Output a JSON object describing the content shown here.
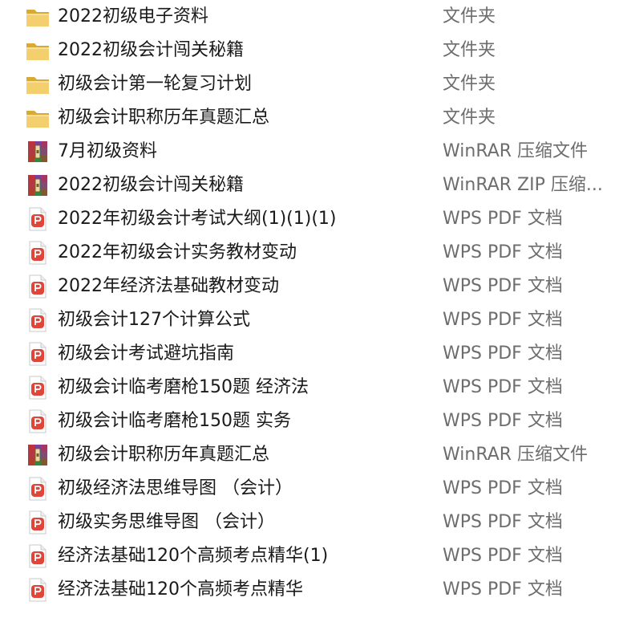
{
  "files": [
    {
      "name": "2022初级电子资料",
      "type": "文件夹",
      "icon": "folder-icon"
    },
    {
      "name": "2022初级会计闯关秘籍",
      "type": "文件夹",
      "icon": "folder-icon"
    },
    {
      "name": "初级会计第一轮复习计划",
      "type": "文件夹",
      "icon": "folder-icon"
    },
    {
      "name": "初级会计职称历年真题汇总",
      "type": "文件夹",
      "icon": "folder-icon"
    },
    {
      "name": "7月初级资料",
      "type": "WinRAR 压缩文件",
      "icon": "winrar-archive-icon"
    },
    {
      "name": "2022初级会计闯关秘籍",
      "type": "WinRAR ZIP 压缩...",
      "icon": "winrar-archive-icon"
    },
    {
      "name": "2022年初级会计考试大纲(1)(1)(1)",
      "type": "WPS PDF 文档",
      "icon": "pdf-icon"
    },
    {
      "name": "2022年初级会计实务教材变动",
      "type": "WPS PDF 文档",
      "icon": "pdf-icon"
    },
    {
      "name": "2022年经济法基础教材变动",
      "type": "WPS PDF 文档",
      "icon": "pdf-icon"
    },
    {
      "name": "初级会计127个计算公式",
      "type": "WPS PDF 文档",
      "icon": "pdf-icon"
    },
    {
      "name": "初级会计考试避坑指南",
      "type": "WPS PDF 文档",
      "icon": "pdf-icon"
    },
    {
      "name": "初级会计临考磨枪150题  经济法",
      "type": "WPS PDF 文档",
      "icon": "pdf-icon"
    },
    {
      "name": "初级会计临考磨枪150题  实务",
      "type": "WPS PDF 文档",
      "icon": "pdf-icon"
    },
    {
      "name": "初级会计职称历年真题汇总",
      "type": "WinRAR 压缩文件",
      "icon": "winrar-archive-icon"
    },
    {
      "name": "初级经济法思维导图 （会计）",
      "type": "WPS PDF 文档",
      "icon": "pdf-icon"
    },
    {
      "name": "初级实务思维导图 （会计）",
      "type": "WPS PDF 文档",
      "icon": "pdf-icon"
    },
    {
      "name": "经济法基础120个高频考点精华(1)",
      "type": "WPS PDF 文档",
      "icon": "pdf-icon"
    },
    {
      "name": "经济法基础120个高频考点精华",
      "type": "WPS PDF 文档",
      "icon": "pdf-icon"
    }
  ],
  "colors": {
    "folder": "#e8c15a",
    "pdf": "#e0453a",
    "winrar_purple": "#7a3fa0",
    "winrar_red": "#c8302c",
    "winrar_green": "#2e8b3a"
  }
}
